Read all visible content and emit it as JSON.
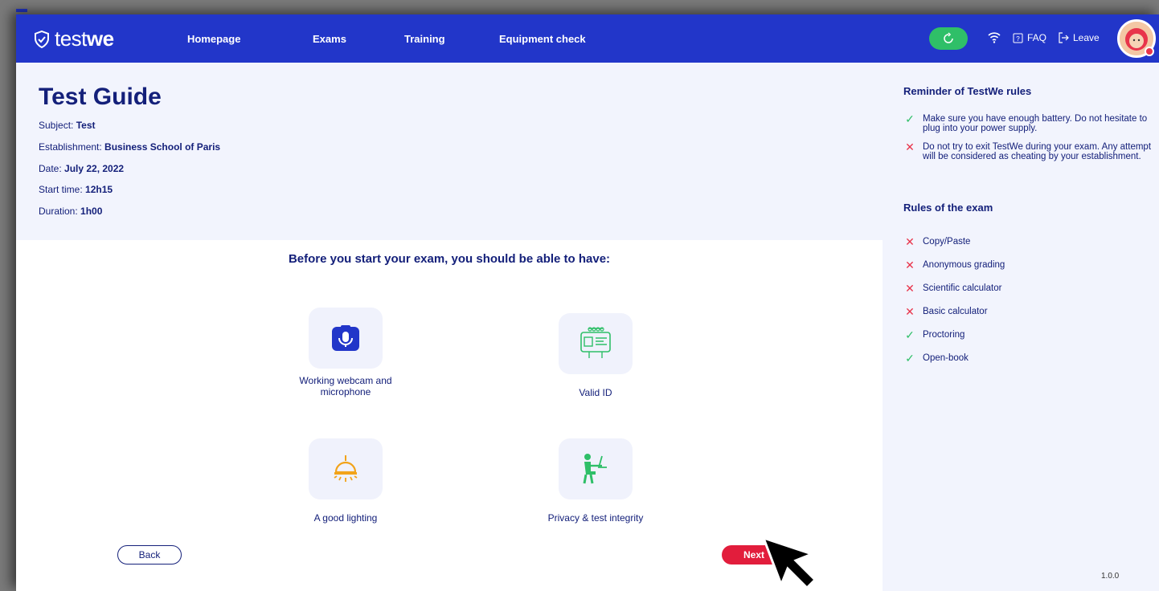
{
  "app": {
    "logo_text_light": "test",
    "logo_text_bold": "we"
  },
  "nav": {
    "items": [
      "Homepage",
      "Exams",
      "Training",
      "Equipment check"
    ]
  },
  "header_right": {
    "faq_label": "FAQ",
    "leave_label": "Leave"
  },
  "guide": {
    "title": "Test Guide",
    "fields": [
      {
        "label": "Subject: ",
        "value": "Test"
      },
      {
        "label": "Establishment: ",
        "value": "Business School of Paris"
      },
      {
        "label": "Date: ",
        "value": "July 22, 2022"
      },
      {
        "label": "Start time: ",
        "value": "12h15"
      },
      {
        "label": "Duration: ",
        "value": "1h00"
      }
    ]
  },
  "requirements": {
    "heading": "Before you start your exam, you should be able to have:",
    "items": [
      {
        "label": "Working webcam and microphone",
        "icon": "webcam-microphone-icon"
      },
      {
        "label": "Valid ID",
        "icon": "id-card-icon"
      },
      {
        "label": "A good lighting",
        "icon": "lamp-icon"
      },
      {
        "label": "Privacy & test integrity",
        "icon": "person-at-desk-icon"
      }
    ]
  },
  "sidebar": {
    "reminder_title": "Reminder of TestWe rules",
    "reminders": [
      {
        "status": "ok",
        "text": "Make sure you have enough battery. Do not hesitate to plug into your power supply."
      },
      {
        "status": "no",
        "text": "Do not try to exit TestWe during your exam. Any attempt will be considered as cheating by your establishment."
      }
    ],
    "rules_title": "Rules of the exam",
    "rules": [
      {
        "status": "no",
        "text": "Copy/Paste"
      },
      {
        "status": "no",
        "text": "Anonymous grading"
      },
      {
        "status": "no",
        "text": "Scientific calculator"
      },
      {
        "status": "no",
        "text": "Basic calculator"
      },
      {
        "status": "ok",
        "text": "Proctoring"
      },
      {
        "status": "ok",
        "text": "Open-book"
      }
    ],
    "version": "1.0.0"
  },
  "buttons": {
    "back": "Back",
    "next": "Next"
  },
  "colors": {
    "brand_blue": "#2236c9",
    "navy_text": "#14207a",
    "accent_red": "#e21d3c",
    "ok_green": "#2fbf68",
    "panel_bg": "#f2f4fd"
  }
}
